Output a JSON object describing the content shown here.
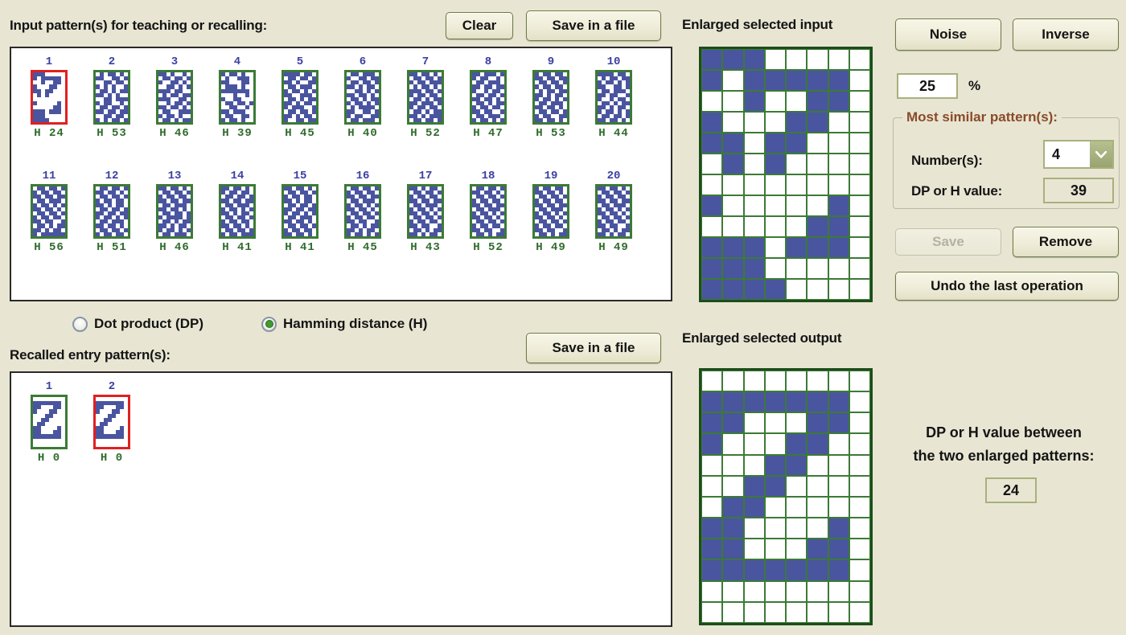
{
  "header": {
    "input_label": "Input pattern(s) for teaching or recalling:",
    "clear_button": "Clear",
    "save_file_button": "Save in a file",
    "enlarged_input_label": "Enlarged selected input"
  },
  "controls": {
    "noise_button": "Noise",
    "inverse_button": "Inverse",
    "noise_value": "25",
    "percent_symbol": "%",
    "group_title": "Most similar pattern(s):",
    "numbers_label": "Number(s):",
    "numbers_value": "4",
    "dp_h_label": "DP or H value:",
    "dp_h_value": "39",
    "save_button": "Save",
    "remove_button": "Remove",
    "undo_button": "Undo the last operation"
  },
  "metric": {
    "dp_option": "Dot product (DP)",
    "hamming_option": "Hamming distance (H)",
    "selected": "hamming"
  },
  "recalled": {
    "label": "Recalled entry pattern(s):",
    "save_file_button": "Save in a file",
    "enlarged_output_label": "Enlarged selected output",
    "items": [
      {
        "num": "1",
        "h": "H 0",
        "selected": false
      },
      {
        "num": "2",
        "h": "H 0",
        "selected": true
      }
    ]
  },
  "comparison": {
    "line1": "DP or H value between",
    "line2": "the two enlarged patterns:",
    "value": "24"
  },
  "colors": {
    "background": "#e8e6d3",
    "pattern_blue": "#4a55a0",
    "grid_green": "#3c7a36",
    "selected_red": "#e02020",
    "label_brown": "#8a4b2a"
  },
  "input_patterns": [
    {
      "num": "1",
      "h": "H 24",
      "selected": true,
      "bits": "11100000 10111110 00100110 10001100 11011000 01010000 00000000 10000010 00000110 11101110 11100000 11110000"
    },
    {
      "num": "2",
      "h": "H 53",
      "selected": false,
      "bits": "01011010 11001101 00110110 10101001 01101011 11010100 00110111 10110010 01101101 11011011 00110110 10101101"
    },
    {
      "num": "3",
      "h": "H 46",
      "selected": false,
      "bits": "11010010 01101101 10011010 00110101 11101100 01011011 11100110 00101101 11011010 01100111 10110100 01101011"
    },
    {
      "num": "4",
      "h": "H 39",
      "selected": false,
      "bits": "10110100 01001110 11000110 01110100 11111110 00010010 10011000 01101101 00110010 11011100 01100110 10110100"
    },
    {
      "num": "5",
      "h": "H 45",
      "selected": false,
      "bits": "11110110 01101101 11010011 01101110 10110101 11001110 01101011 11010110 10111001 01101101 11010110 10011011"
    },
    {
      "num": "6",
      "h": "H 40",
      "selected": false,
      "bits": "01101110 10011011 01101101 11010110 00110101 11011010 01101011 10110101 01011110 11001101 10110011 01101110"
    },
    {
      "num": "7",
      "h": "H 52",
      "selected": false,
      "bits": "11011010 01101101 10110111 01011010 11101101 10110110 01101011 11011101 10110110 01101011 11010111 01101101"
    },
    {
      "num": "8",
      "h": "H 47",
      "selected": false,
      "bits": "11011101 10110010 01101110 11011011 10010110 01101101 11011010 01101011 10110110 11011001 01101110 10110101"
    },
    {
      "num": "9",
      "h": "H 53",
      "selected": false,
      "bits": "10110110 11011011 01101101 10110110 01011011 11010110 10110101 01101110 11011010 01101101 10110011 11011010"
    },
    {
      "num": "10",
      "h": "H 44",
      "selected": false,
      "bits": "11110110 01011011 10110101 11001101 01101110 11011001 10010110 01101011 11010110 10110101 01101101 11011010"
    },
    {
      "num": "11",
      "h": "H 56",
      "selected": false,
      "bits": "01101101 10110110 11011011 01101110 10110101 11011010 01101101 10110110 11011001 01101011 11010110 10111111"
    },
    {
      "num": "12",
      "h": "H 51",
      "selected": false,
      "bits": "01101101 11011010 01101101 10110110 11010110 01101101 11011011 10110101 01101110 11011010 01101101 10110110"
    },
    {
      "num": "13",
      "h": "H 46",
      "selected": false,
      "bits": "11011010 01101101 10110110 11011011 01101110 11011010 01101101 10111101 01101011 11010110 10110101 01101110"
    },
    {
      "num": "14",
      "h": "H 41",
      "selected": false,
      "bits": "11011010 10110110 01101101 11011011 01101110 10110101 11010110 01101101 10110110 11011010 01101101 10110111"
    },
    {
      "num": "15",
      "h": "H 41",
      "selected": false,
      "bits": "11011010 01101101 10110110 11010110 01101101 11011011 10110101 01101110 11011010 01101101 10110110 11011010"
    },
    {
      "num": "16",
      "h": "H 45",
      "selected": false,
      "bits": "01101101 10110110 11011011 01101110 10110101 11011010 01101101 10110110 11011001 01101011 11010110 10110101"
    },
    {
      "num": "17",
      "h": "H 43",
      "selected": false,
      "bits": "11010110 01101101 10110110 11011011 01101110 10110101 11011010 01101101 10110110 11011001 01101011 11010110"
    },
    {
      "num": "18",
      "h": "H 52",
      "selected": false,
      "bits": "01101101 11011010 01101101 10110110 11011011 01101110 10110101 11011010 01101101 10110110 11011001 01101011"
    },
    {
      "num": "19",
      "h": "H 49",
      "selected": false,
      "bits": "10110110 11011010 01101101 10110110 11011011 01101110 10110101 11011010 01101101 10110110 11011001 01101011"
    },
    {
      "num": "20",
      "h": "H 49",
      "selected": false,
      "bits": "11011010 01101101 10110110 11011011 01101110 10110101 11011010 01101101 10110110 11011001 01101011 11010110"
    }
  ],
  "recalled_patterns": [
    {
      "bits": "00000000 11111110 11000110 10001100 00011000 00110000 01100000 11000010 11000110 11111110 00000000 00000000"
    },
    {
      "bits": "00000000 11111110 11000110 10001100 00011000 00110000 01100000 11000010 11000110 11111110 00000000 00000000"
    }
  ],
  "enlarged_input": {
    "rows": 12,
    "cols": 8,
    "bits": [
      "11100000",
      "10111110",
      "00100110",
      "10001100",
      "11011000",
      "01010000",
      "00000000",
      "10000010",
      "00000110",
      "11101110",
      "11100000",
      "11110000"
    ]
  },
  "enlarged_output": {
    "rows": 12,
    "cols": 8,
    "bits": [
      "00000000",
      "11111110",
      "11000110",
      "10001100",
      "00011000",
      "00110000",
      "01100000",
      "11000010",
      "11000110",
      "11111110",
      "00000000",
      "00000000"
    ]
  }
}
